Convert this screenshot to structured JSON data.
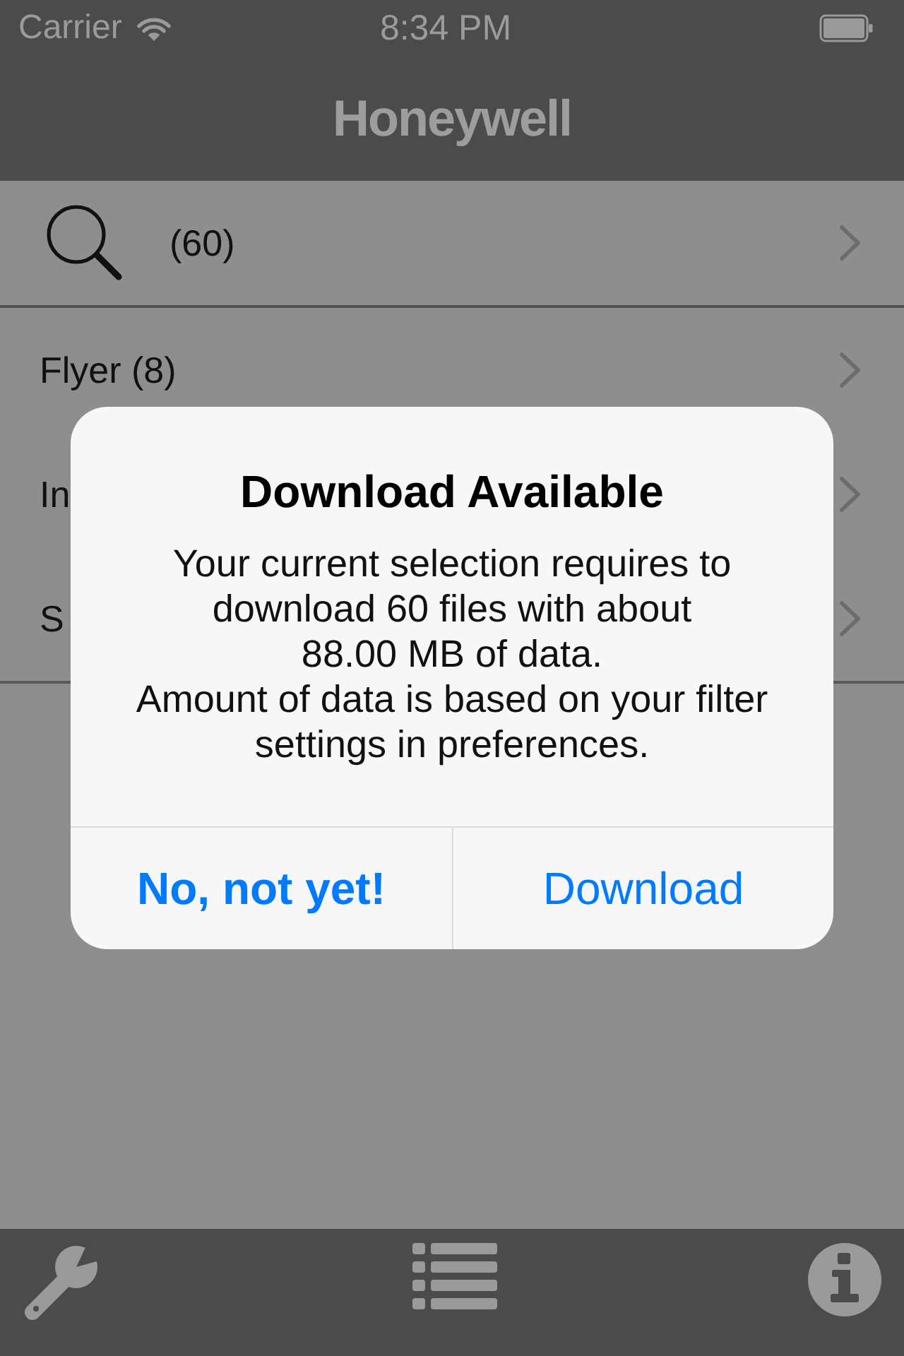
{
  "status_bar": {
    "carrier": "Carrier",
    "time": "8:34 PM"
  },
  "nav_bar": {
    "logo": "Honeywell"
  },
  "list": {
    "rows": [
      {
        "kind": "search",
        "label": "(60)"
      },
      {
        "kind": "text",
        "label": "Flyer (8)"
      },
      {
        "kind": "text",
        "label": "In"
      },
      {
        "kind": "text",
        "label": "S"
      }
    ]
  },
  "alert": {
    "title": "Download Available",
    "message": "Your current selection requires to\ndownload 60 files with about\n88.00 MB of data.\nAmount of data is based on your filter\nsettings in preferences.",
    "buttons": [
      {
        "label": "No, not yet!",
        "preferred": true
      },
      {
        "label": "Download",
        "preferred": false
      }
    ]
  }
}
